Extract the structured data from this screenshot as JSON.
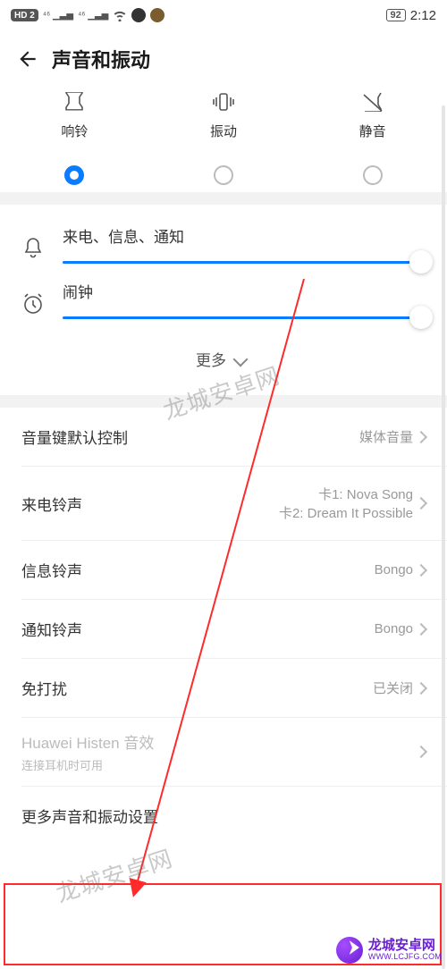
{
  "status": {
    "hd": "HD 2",
    "sig1": "⁴⁶ ▁▃▅",
    "sig2": "⁴⁶ ▁▃▅",
    "wifi": "⋮",
    "battery": "92",
    "time": "2:12"
  },
  "header": {
    "title": "声音和振动"
  },
  "modes": [
    {
      "key": "ring",
      "label": "响铃",
      "active": true
    },
    {
      "key": "vibrate",
      "label": "振动",
      "active": false
    },
    {
      "key": "silent",
      "label": "静音",
      "active": false
    }
  ],
  "sliders": {
    "call": {
      "label": "来电、信息、通知",
      "value": 100
    },
    "alarm": {
      "label": "闹钟",
      "value": 100
    }
  },
  "more_label": "更多",
  "list": {
    "volume_key": {
      "label": "音量键默认控制",
      "value": "媒体音量"
    },
    "ringtone": {
      "label": "来电铃声",
      "value_line1": "卡1: Nova Song",
      "value_line2": "卡2: Dream It Possible"
    },
    "message": {
      "label": "信息铃声",
      "value": "Bongo"
    },
    "notify": {
      "label": "通知铃声",
      "value": "Bongo"
    },
    "dnd": {
      "label": "免打扰",
      "value": "已关闭"
    },
    "histen": {
      "label": "Huawei Histen 音效",
      "sub": "连接耳机时可用"
    },
    "more_sound": {
      "label": "更多声音和振动设置"
    }
  },
  "watermark": {
    "text1": "龙城安卓网",
    "text2": "龙城安卓网"
  },
  "badge": {
    "cn": "龙城安卓网",
    "en": "WWW.LCJFG.COM"
  }
}
